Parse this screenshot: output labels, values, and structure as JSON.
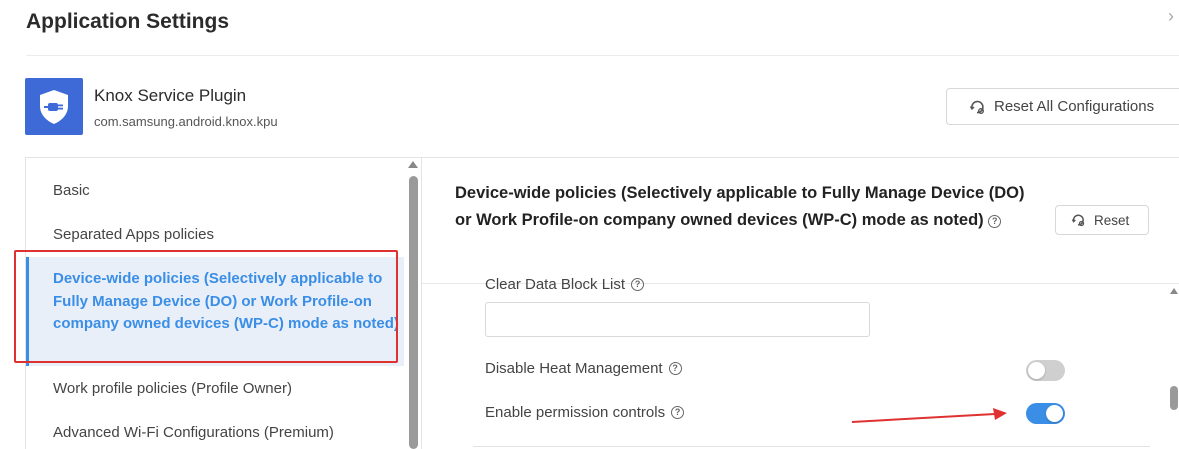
{
  "header": {
    "title": "Application Settings",
    "close_icon": "chevron-right-icon"
  },
  "app": {
    "name": "Knox Service Plugin",
    "package": "com.samsung.android.knox.kpu",
    "icon": "shield-plug-icon",
    "icon_color": "#3d6ad6"
  },
  "toolbar": {
    "reset_all_label": "Reset All Configurations",
    "reset_icon": "reset-gear-icon"
  },
  "sidebar": {
    "items": [
      {
        "label": "Basic"
      },
      {
        "label": "Separated Apps policies"
      },
      {
        "label": "Device-wide policies (Selectively applicable to Fully Manage Device (DO) or Work Profile-on company owned devices (WP-C) mode as noted)",
        "active": true
      },
      {
        "label": "Work profile policies (Profile Owner)"
      },
      {
        "label": "Advanced Wi-Fi Configurations (Premium)"
      }
    ]
  },
  "section": {
    "title": "Device-wide policies (Selectively applicable to Fully Manage Device (DO) or Work Profile-on company owned devices (WP-C) mode as noted)",
    "help_glyph": "?",
    "reset_label": "Reset"
  },
  "fields": {
    "clear_data_block_list": {
      "label": "Clear Data Block List",
      "value": "",
      "placeholder": ""
    },
    "disable_heat_management": {
      "label": "Disable Heat Management",
      "enabled": false
    },
    "enable_permission_controls": {
      "label": "Enable permission controls",
      "enabled": true
    }
  },
  "colors": {
    "accent": "#3a8ee6",
    "annotation": "#e03131",
    "active_bg": "#e9eff9"
  }
}
